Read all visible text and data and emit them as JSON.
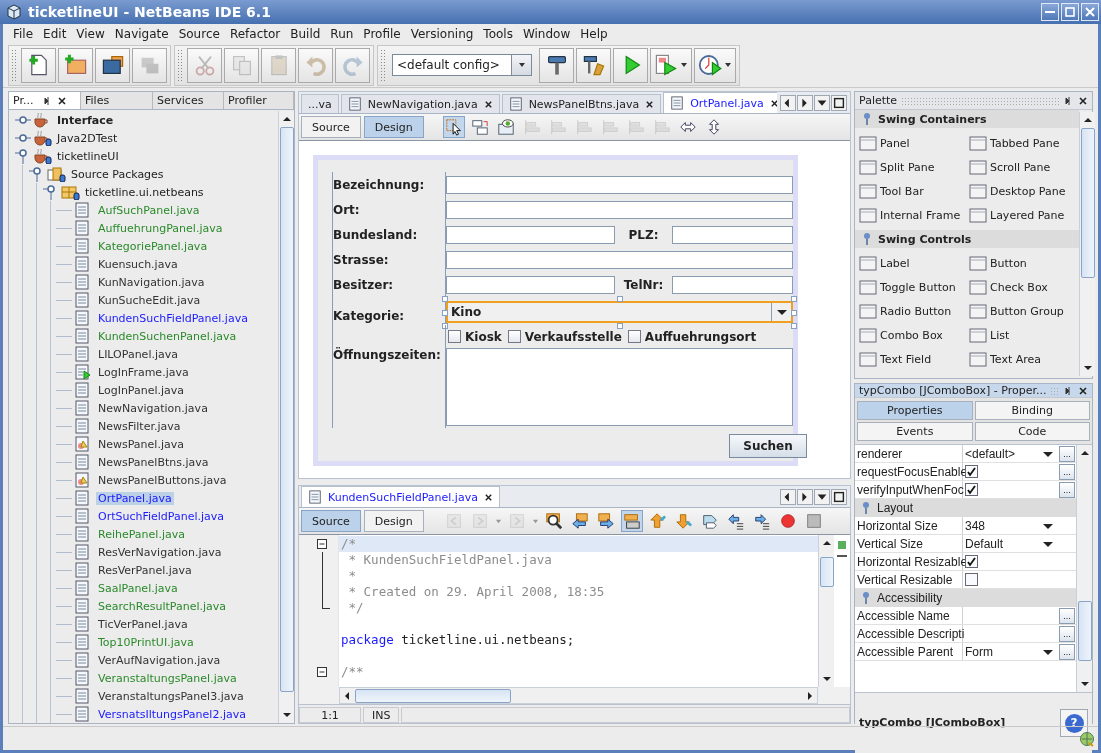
{
  "window": {
    "title": "ticketlineUI - NetBeans IDE 6.1"
  },
  "menu": [
    "File",
    "Edit",
    "View",
    "Navigate",
    "Source",
    "Refactor",
    "Build",
    "Run",
    "Profile",
    "Versioning",
    "Tools",
    "Window",
    "Help"
  ],
  "toolbar": {
    "groups": [
      [
        {
          "kind": "new-file",
          "disabled": false
        },
        {
          "kind": "new-project",
          "disabled": false
        },
        {
          "kind": "open-project",
          "disabled": false
        },
        {
          "kind": "close-project",
          "disabled": true
        }
      ],
      [
        {
          "kind": "cut",
          "disabled": true
        },
        {
          "kind": "copy",
          "disabled": true
        },
        {
          "kind": "paste",
          "disabled": true
        },
        {
          "kind": "undo",
          "disabled": true
        },
        {
          "kind": "redo",
          "disabled": true
        }
      ]
    ],
    "config": "<default config>",
    "actions": [
      {
        "kind": "build",
        "dropdown": false
      },
      {
        "kind": "clean-build",
        "dropdown": false
      },
      {
        "kind": "run",
        "dropdown": false
      },
      {
        "kind": "debug",
        "dropdown": true
      },
      {
        "kind": "profile",
        "dropdown": true
      }
    ]
  },
  "projects_panel": {
    "tabs": [
      {
        "label": "Pr...",
        "selected": true
      },
      {
        "label": "Files",
        "selected": false
      },
      {
        "label": "Services",
        "selected": false
      },
      {
        "label": "Profiler",
        "selected": false
      }
    ],
    "tree": [
      {
        "label": "Interface",
        "kind": "project",
        "bold": true,
        "versioned": false,
        "expanded": false
      },
      {
        "label": "Java2DTest",
        "kind": "project",
        "bold": false,
        "versioned": true,
        "expanded": false
      },
      {
        "label": "ticketlineUI",
        "kind": "project",
        "bold": false,
        "versioned": true,
        "expanded": true,
        "children": [
          {
            "label": "Source Packages",
            "kind": "source-root",
            "bold": false,
            "versioned": true,
            "expanded": true,
            "children": [
              {
                "label": "ticketline.ui.netbeans",
                "kind": "package",
                "bold": false,
                "versioned": true,
                "expanded": true,
                "children": [
                  {
                    "label": "AufSuchPanel.java",
                    "kind": "form",
                    "color": "#2a8a2a",
                    "selected": false
                  },
                  {
                    "label": "AuffuehrungPanel.java",
                    "kind": "form",
                    "color": "#2a8a2a",
                    "selected": false
                  },
                  {
                    "label": "KategoriePanel.java",
                    "kind": "form",
                    "color": "#2a8a2a",
                    "selected": false
                  },
                  {
                    "label": "Kuensuch.java",
                    "kind": "form",
                    "color": "#333333",
                    "selected": false
                  },
                  {
                    "label": "KunNavigation.java",
                    "kind": "form",
                    "color": "#333333",
                    "selected": false
                  },
                  {
                    "label": "KunSucheEdit.java",
                    "kind": "form",
                    "color": "#333333",
                    "selected": false
                  },
                  {
                    "label": "KundenSuchFieldPanel.java",
                    "kind": "form",
                    "color": "#1a1aff",
                    "selected": false
                  },
                  {
                    "label": "KundenSuchenPanel.java",
                    "kind": "form",
                    "color": "#2a8a2a",
                    "selected": false
                  },
                  {
                    "label": "LILOPanel.java",
                    "kind": "form",
                    "color": "#333333",
                    "selected": false
                  },
                  {
                    "label": "LogInFrame.java",
                    "kind": "main-form",
                    "color": "#333333",
                    "selected": false
                  },
                  {
                    "label": "LogInPanel.java",
                    "kind": "form",
                    "color": "#333333",
                    "selected": false
                  },
                  {
                    "label": "NewNavigation.java",
                    "kind": "form",
                    "color": "#333333",
                    "selected": false
                  },
                  {
                    "label": "NewsFilter.java",
                    "kind": "form",
                    "color": "#333333",
                    "selected": false
                  },
                  {
                    "label": "NewsPanel.java",
                    "kind": "gui-class",
                    "color": "#333333",
                    "selected": false
                  },
                  {
                    "label": "NewsPanelBtns.java",
                    "kind": "form",
                    "color": "#333333",
                    "selected": false
                  },
                  {
                    "label": "NewsPanelButtons.java",
                    "kind": "gui-class",
                    "color": "#333333",
                    "selected": false
                  },
                  {
                    "label": "OrtPanel.java",
                    "kind": "form",
                    "color": "#1a1aff",
                    "selected": true
                  },
                  {
                    "label": "OrtSuchFieldPanel.java",
                    "kind": "form",
                    "color": "#1a1aff",
                    "selected": false
                  },
                  {
                    "label": "ReihePanel.java",
                    "kind": "form",
                    "color": "#2a8a2a",
                    "selected": false
                  },
                  {
                    "label": "ResVerNavigation.java",
                    "kind": "form",
                    "color": "#333333",
                    "selected": false
                  },
                  {
                    "label": "ResVerPanel.java",
                    "kind": "form",
                    "color": "#333333",
                    "selected": false
                  },
                  {
                    "label": "SaalPanel.java",
                    "kind": "form",
                    "color": "#2a8a2a",
                    "selected": false
                  },
                  {
                    "label": "SearchResultPanel.java",
                    "kind": "form",
                    "color": "#2a8a2a",
                    "selected": false
                  },
                  {
                    "label": "TicVerPanel.java",
                    "kind": "form",
                    "color": "#333333",
                    "selected": false
                  },
                  {
                    "label": "Top10PrintUI.java",
                    "kind": "form",
                    "color": "#2a8a2a",
                    "selected": false
                  },
                  {
                    "label": "VerAufNavigation.java",
                    "kind": "form",
                    "color": "#333333",
                    "selected": false
                  },
                  {
                    "label": "VeranstaltungsPanel.java",
                    "kind": "form",
                    "color": "#2a8a2a",
                    "selected": false
                  },
                  {
                    "label": "VeranstaltungsPanel3.java",
                    "kind": "form",
                    "color": "#333333",
                    "selected": false
                  },
                  {
                    "label": "VersnatsIltungsPanel2.java",
                    "kind": "form",
                    "color": "#1a1aff",
                    "selected": false
                  }
                ]
              }
            ]
          }
        ]
      }
    ]
  },
  "designer": {
    "tabs": [
      {
        "label": "...va",
        "icon": false,
        "selected": false
      },
      {
        "label": "NewNavigation.java",
        "icon": true,
        "selected": false
      },
      {
        "label": "NewsPanelBtns.java",
        "icon": true,
        "selected": false
      },
      {
        "label": "OrtPanel.java",
        "icon": true,
        "selected": true
      }
    ],
    "views": [
      {
        "label": "Source",
        "selected": false
      },
      {
        "label": "Design",
        "selected": true
      }
    ],
    "tools": [
      {
        "kind": "selection",
        "selected": true,
        "disabled": false
      },
      {
        "kind": "connection",
        "selected": false,
        "disabled": false
      },
      {
        "kind": "preview",
        "selected": false,
        "disabled": false
      },
      {
        "kind": "align",
        "selected": false,
        "disabled": true
      },
      {
        "kind": "align",
        "selected": false,
        "disabled": true
      },
      {
        "kind": "align",
        "selected": false,
        "disabled": true
      },
      {
        "kind": "align",
        "selected": false,
        "disabled": true
      },
      {
        "kind": "align",
        "selected": false,
        "disabled": true
      },
      {
        "kind": "align",
        "selected": false,
        "disabled": true
      },
      {
        "kind": "resize-horizontal",
        "selected": false,
        "disabled": false
      },
      {
        "kind": "resize-vertical",
        "selected": false,
        "disabled": false
      }
    ],
    "form": {
      "rows": [
        {
          "kind": "text",
          "label": "Bezeichnung:"
        },
        {
          "kind": "text",
          "label": "Ort:"
        },
        {
          "kind": "split",
          "label": "Bundesland:",
          "label2": "PLZ:"
        },
        {
          "kind": "text",
          "label": "Strasse:"
        },
        {
          "kind": "split",
          "label": "Besitzer:",
          "label2": "TelNr:"
        },
        {
          "kind": "combo",
          "label": "Kategorie:",
          "value": "Kino",
          "selected": true
        },
        {
          "kind": "checks",
          "items": [
            {
              "label": "Kiosk",
              "checked": false
            },
            {
              "label": "Verkaufsstelle",
              "checked": false
            },
            {
              "label": "Auffuehrungsort",
              "checked": false
            }
          ]
        },
        {
          "kind": "area",
          "label": "Öffnungszeiten:"
        }
      ],
      "button": "Suchen"
    }
  },
  "source_editor": {
    "tabs": [
      {
        "label": "KundenSuchFieldPanel.java",
        "selected": true
      }
    ],
    "views": [
      {
        "label": "Source",
        "selected": true
      },
      {
        "label": "Design",
        "selected": false
      }
    ],
    "tools": [
      {
        "kind": "back",
        "selected": false,
        "disabled": true
      },
      {
        "kind": "forward",
        "selected": false,
        "disabled": true
      },
      {
        "kind": "forward",
        "selected": false,
        "disabled": true
      },
      {
        "kind": "find",
        "selected": false,
        "disabled": false
      },
      {
        "kind": "find-previous",
        "selected": false,
        "disabled": false
      },
      {
        "kind": "find-next",
        "selected": false,
        "disabled": false
      },
      {
        "kind": "highlight",
        "selected": true,
        "disabled": false
      },
      {
        "kind": "bookmark-previous",
        "selected": false,
        "disabled": false
      },
      {
        "kind": "bookmark-next",
        "selected": false,
        "disabled": false
      },
      {
        "kind": "bookmark-toggle",
        "selected": false,
        "disabled": false
      },
      {
        "kind": "shift-left",
        "selected": false,
        "disabled": false
      },
      {
        "kind": "shift-right",
        "selected": false,
        "disabled": false
      },
      {
        "kind": "record",
        "selected": false,
        "disabled": false
      },
      {
        "kind": "stop",
        "selected": false,
        "disabled": false
      }
    ],
    "lines": [
      {
        "kind": "comment",
        "text": "/*",
        "fold_open": true,
        "fold_body": false,
        "fold_end": false,
        "current": true
      },
      {
        "kind": "comment",
        "text": " * KundenSuchFieldPanel.java",
        "fold_open": false,
        "fold_body": true,
        "fold_end": false,
        "current": false
      },
      {
        "kind": "comment",
        "text": " *",
        "fold_open": false,
        "fold_body": true,
        "fold_end": false,
        "current": false
      },
      {
        "kind": "comment",
        "text": " * Created on 29. April 2008, 18:35",
        "fold_open": false,
        "fold_body": true,
        "fold_end": false,
        "current": false
      },
      {
        "kind": "comment",
        "text": " */",
        "fold_open": false,
        "fold_body": false,
        "fold_end": true,
        "current": false
      },
      {
        "kind": "blank",
        "fold_open": false,
        "fold_body": false,
        "fold_end": false,
        "current": false
      },
      {
        "kind": "code",
        "keyword": "package",
        "text": "ticketline.ui.netbeans;",
        "fold_open": false,
        "fold_body": false,
        "fold_end": false,
        "current": false
      },
      {
        "kind": "blank",
        "fold_open": false,
        "fold_body": false,
        "fold_end": false,
        "current": false
      },
      {
        "kind": "comment",
        "text": "/**",
        "fold_open": true,
        "fold_body": false,
        "fold_end": false,
        "current": false
      }
    ],
    "position": "1:1",
    "mode": "INS"
  },
  "palette": {
    "title": "Palette",
    "categories": [
      {
        "name": "Swing Containers",
        "items": [
          "Panel",
          "Tabbed Pane",
          "Split Pane",
          "Scroll Pane",
          "Tool Bar",
          "Desktop Pane",
          "Internal Frame",
          "Layered Pane"
        ]
      },
      {
        "name": "Swing Controls",
        "items": [
          "Label",
          "Button",
          "Toggle Button",
          "Check Box",
          "Radio Button",
          "Button Group",
          "Combo Box",
          "List",
          "Text Field",
          "Text Area"
        ]
      }
    ]
  },
  "properties": {
    "title": "typCombo [JComboBox] - Proper...",
    "tabs": [
      {
        "label": "Properties",
        "selected": true
      },
      {
        "label": "Binding",
        "selected": false
      },
      {
        "label": "Events",
        "selected": false
      },
      {
        "label": "Code",
        "selected": false
      }
    ],
    "rows": [
      {
        "kind": "combo",
        "name": "renderer",
        "value": "<default>",
        "more": "..."
      },
      {
        "kind": "check",
        "name": "requestFocusEnable",
        "checked": true,
        "more": "..."
      },
      {
        "kind": "check",
        "name": "verifyInputWhenFoc",
        "checked": true,
        "more": "..."
      },
      {
        "kind": "section",
        "name": "Layout"
      },
      {
        "kind": "combo",
        "name": "Horizontal Size",
        "value": "348"
      },
      {
        "kind": "combo",
        "name": "Vertical Size",
        "value": "Default"
      },
      {
        "kind": "check",
        "name": "Horizontal Resizable",
        "checked": true
      },
      {
        "kind": "check",
        "name": "Vertical Resizable",
        "checked": false
      },
      {
        "kind": "section",
        "name": "Accessibility"
      },
      {
        "kind": "text",
        "name": "Accessible Name",
        "more": "..."
      },
      {
        "kind": "text",
        "name": "Accessible Descripti",
        "more": "..."
      },
      {
        "kind": "combo",
        "name": "Accessible Parent",
        "value": "Form",
        "more": "..."
      }
    ],
    "description": "typCombo [JComboBox]",
    "help": "?"
  }
}
